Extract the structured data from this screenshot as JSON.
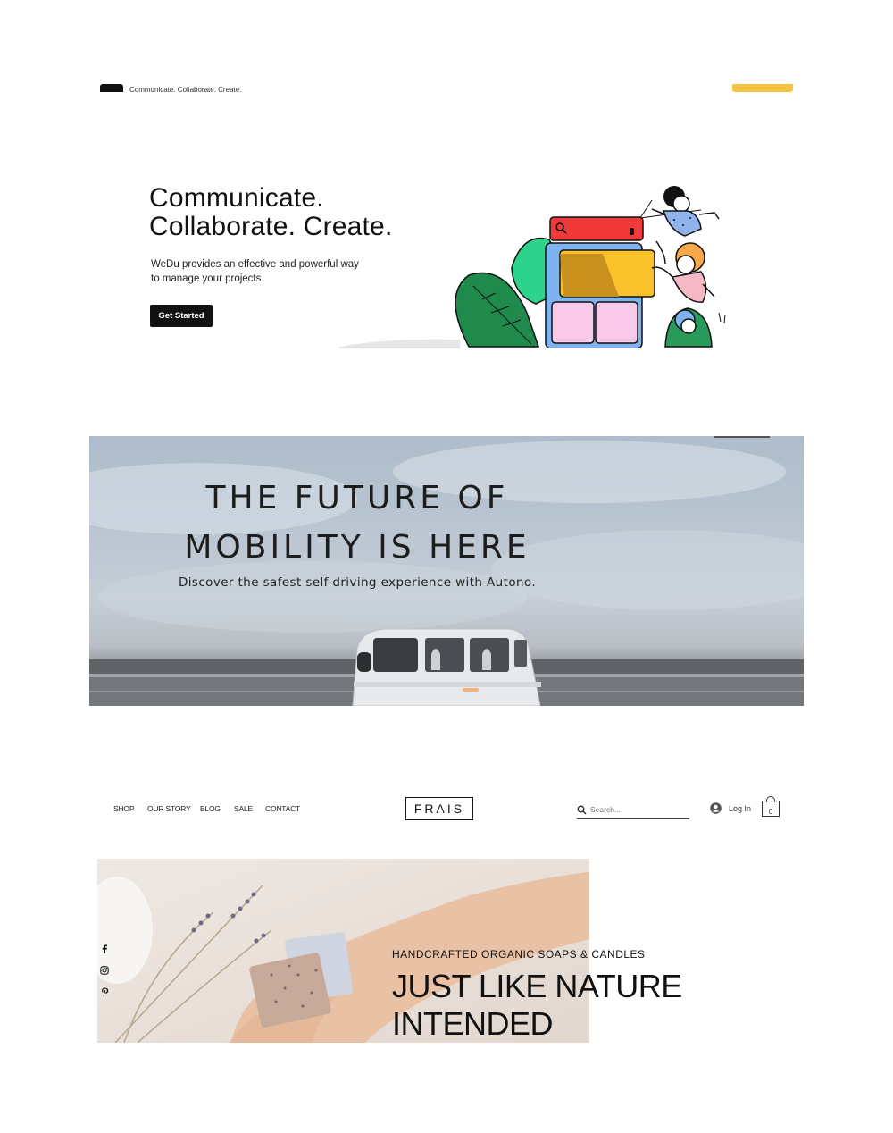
{
  "wedu": {
    "topbar_tagline": "Communicate. Collaborate. Create.",
    "title_line1": "Communicate.",
    "title_line2": "Collaborate. Create.",
    "description": "WeDu provides an effective and powerful way to manage your projects",
    "cta_label": "Get Started",
    "colors": {
      "accent": "#f5c242",
      "button": "#111111"
    }
  },
  "autono": {
    "headline_line1": "THE FUTURE OF",
    "headline_line2": "MOBILITY IS HERE",
    "subheadline": "Discover the safest self-driving experience with Autono."
  },
  "frais": {
    "nav": [
      "SHOP",
      "OUR STORY",
      "BLOG",
      "SALE",
      "CONTACT"
    ],
    "logo": "FRAIS",
    "search_placeholder": "Search...",
    "login_label": "Log In",
    "cart_count": "0",
    "social_icons": [
      "facebook-icon",
      "instagram-icon",
      "pinterest-icon"
    ],
    "kicker": "HANDCRAFTED ORGANIC SOAPS & CANDLES",
    "headline_line1": "JUST LIKE NATURE",
    "headline_line2": "INTENDED"
  }
}
